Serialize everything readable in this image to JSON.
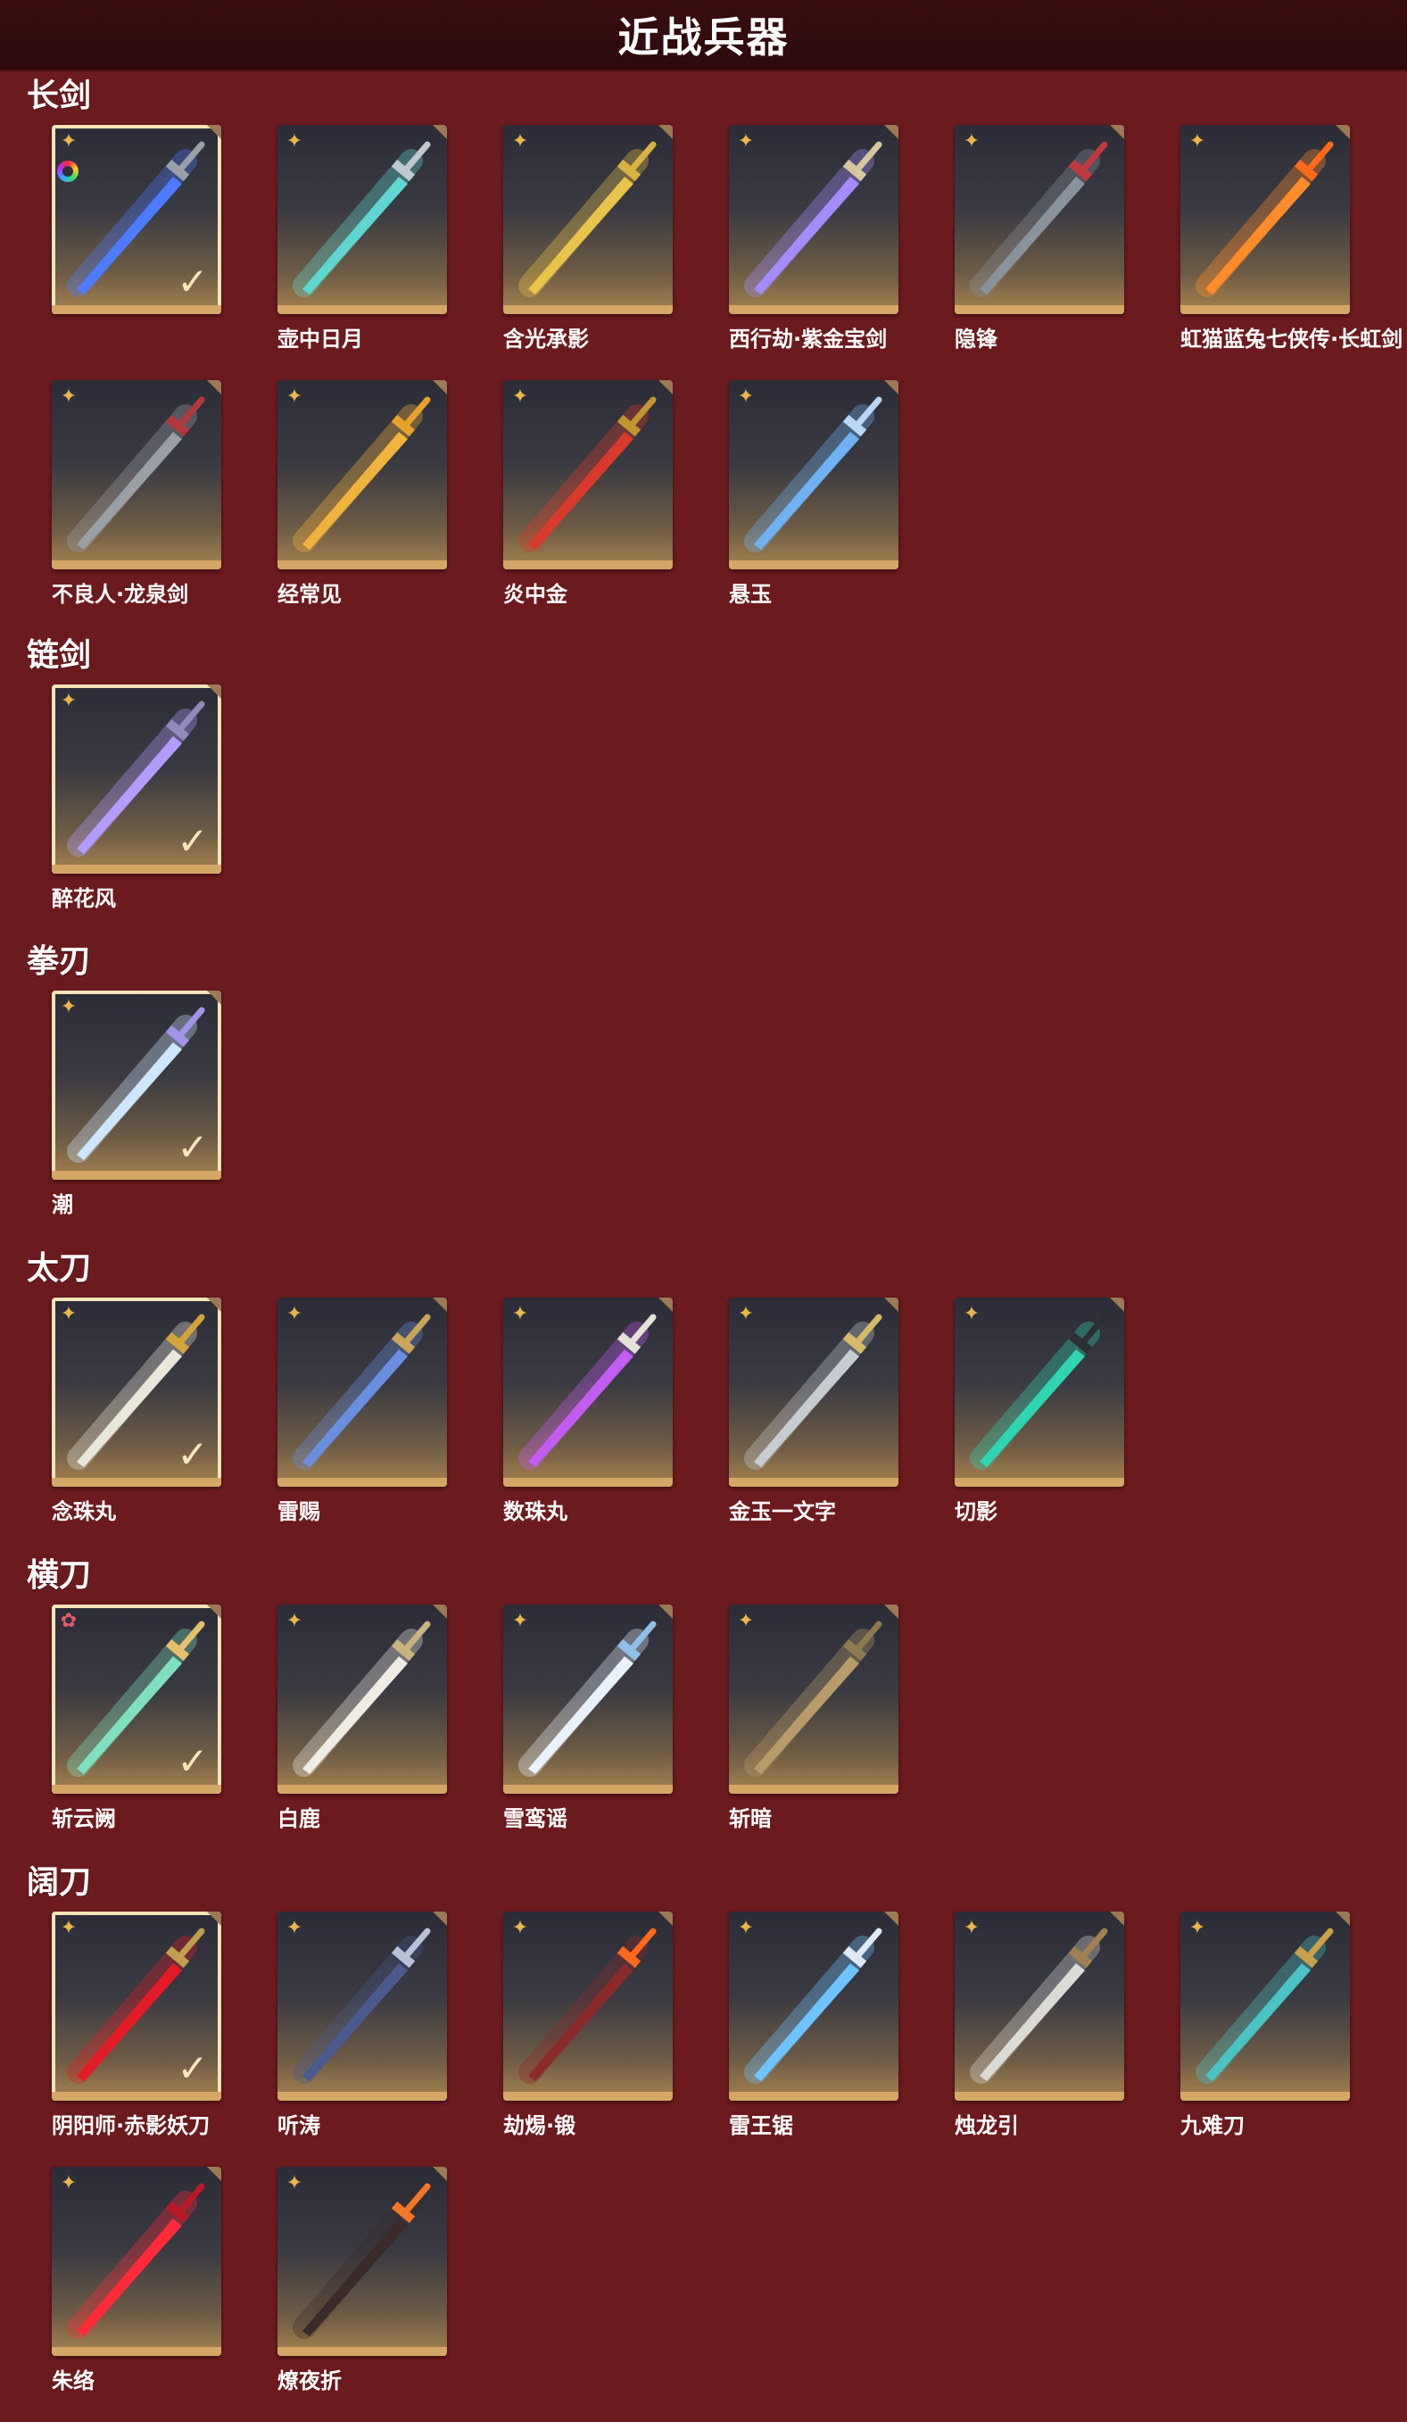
{
  "header": {
    "title": "近战兵器"
  },
  "colors": {
    "background": "#6b1a1e",
    "header": "#2b0a0c",
    "star": "#e8b64b",
    "selected_border": "#f5e4b6"
  },
  "sections": [
    {
      "title": "长剑",
      "items": [
        {
          "name": "",
          "selected": true,
          "dye_icon": true,
          "blade": "#4d7bff",
          "hilt": "#9aa0a8"
        },
        {
          "name": "壶中日月",
          "selected": false,
          "blade": "#5fd6d0",
          "hilt": "#bfc8cf"
        },
        {
          "name": "含光承影",
          "selected": false,
          "blade": "#e7c44a",
          "hilt": "#d7b441"
        },
        {
          "name": "西行劫·紫金宝剑",
          "selected": false,
          "blade": "#a48cff",
          "hilt": "#d7c7a0"
        },
        {
          "name": "隐锋",
          "selected": false,
          "blade": "#8a929c",
          "hilt": "#c0393f"
        },
        {
          "name": "虹猫蓝兔七侠传·长虹剑",
          "selected": false,
          "blade": "#ff8b2a",
          "hilt": "#ff6a1a"
        },
        {
          "name": "不良人·龙泉剑",
          "selected": false,
          "blade": "#9a9fa6",
          "hilt": "#b2383b"
        },
        {
          "name": "经常见",
          "selected": false,
          "blade": "#f0b33d",
          "hilt": "#e7a12c"
        },
        {
          "name": "炎中金",
          "selected": false,
          "blade": "#d93a2c",
          "hilt": "#c2962e"
        },
        {
          "name": "悬玉",
          "selected": false,
          "blade": "#6fb1f2",
          "hilt": "#b7d7f5"
        }
      ]
    },
    {
      "title": "链剑",
      "items": [
        {
          "name": "醉花风",
          "selected": true,
          "blade": "#b49cff",
          "hilt": "#8f8ab8"
        }
      ]
    },
    {
      "title": "拳刃",
      "items": [
        {
          "name": "潮",
          "selected": true,
          "blade": "#cfe6ff",
          "hilt": "#a093e8"
        }
      ]
    },
    {
      "title": "太刀",
      "items": [
        {
          "name": "念珠丸",
          "selected": true,
          "blade": "#e9e6da",
          "hilt": "#d2a53a"
        },
        {
          "name": "雷赐",
          "selected": false,
          "blade": "#6a8fe0",
          "hilt": "#c9a75a"
        },
        {
          "name": "数珠丸",
          "selected": false,
          "blade": "#c35cf0",
          "hilt": "#e5e1d8"
        },
        {
          "name": "金玉一文字",
          "selected": false,
          "blade": "#c7ccd1",
          "hilt": "#d7b96a"
        },
        {
          "name": "切影",
          "selected": false,
          "blade": "#2fd5b3",
          "hilt": "#2b2f33"
        }
      ]
    },
    {
      "title": "横刀",
      "items": [
        {
          "name": "斩云阙",
          "selected": true,
          "red_star": true,
          "blade": "#7fe0c0",
          "hilt": "#e3c16b"
        },
        {
          "name": "白鹿",
          "selected": false,
          "blade": "#efece4",
          "hilt": "#c9b27d"
        },
        {
          "name": "雪鸾谣",
          "selected": false,
          "blade": "#e9f2fb",
          "hilt": "#8fc0e8"
        },
        {
          "name": "斩暗",
          "selected": false,
          "blade": "#b79b6a",
          "hilt": "#8e7a4f"
        }
      ]
    },
    {
      "title": "阔刀",
      "items": [
        {
          "name": "阴阳师·赤影妖刀",
          "selected": true,
          "blade": "#e31b26",
          "hilt": "#c0a04e"
        },
        {
          "name": "听涛",
          "selected": false,
          "blade": "#4a5a8c",
          "hilt": "#b8c2d6"
        },
        {
          "name": "劫焬·锻",
          "selected": false,
          "blade": "#8a2a2a",
          "hilt": "#ff6a1a"
        },
        {
          "name": "雷王锯",
          "selected": false,
          "blade": "#6fc3ff",
          "hilt": "#dfe9f3"
        },
        {
          "name": "烛龙引",
          "selected": false,
          "blade": "#dcdad4",
          "hilt": "#a28050"
        },
        {
          "name": "九难刀",
          "selected": false,
          "blade": "#4bc2c4",
          "hilt": "#c8a24a"
        },
        {
          "name": "朱络",
          "selected": false,
          "blade": "#ff2b3a",
          "hilt": "#b81a27"
        },
        {
          "name": "燎夜折",
          "selected": false,
          "blade": "#3a2a2a",
          "hilt": "#f2762a"
        }
      ]
    }
  ]
}
